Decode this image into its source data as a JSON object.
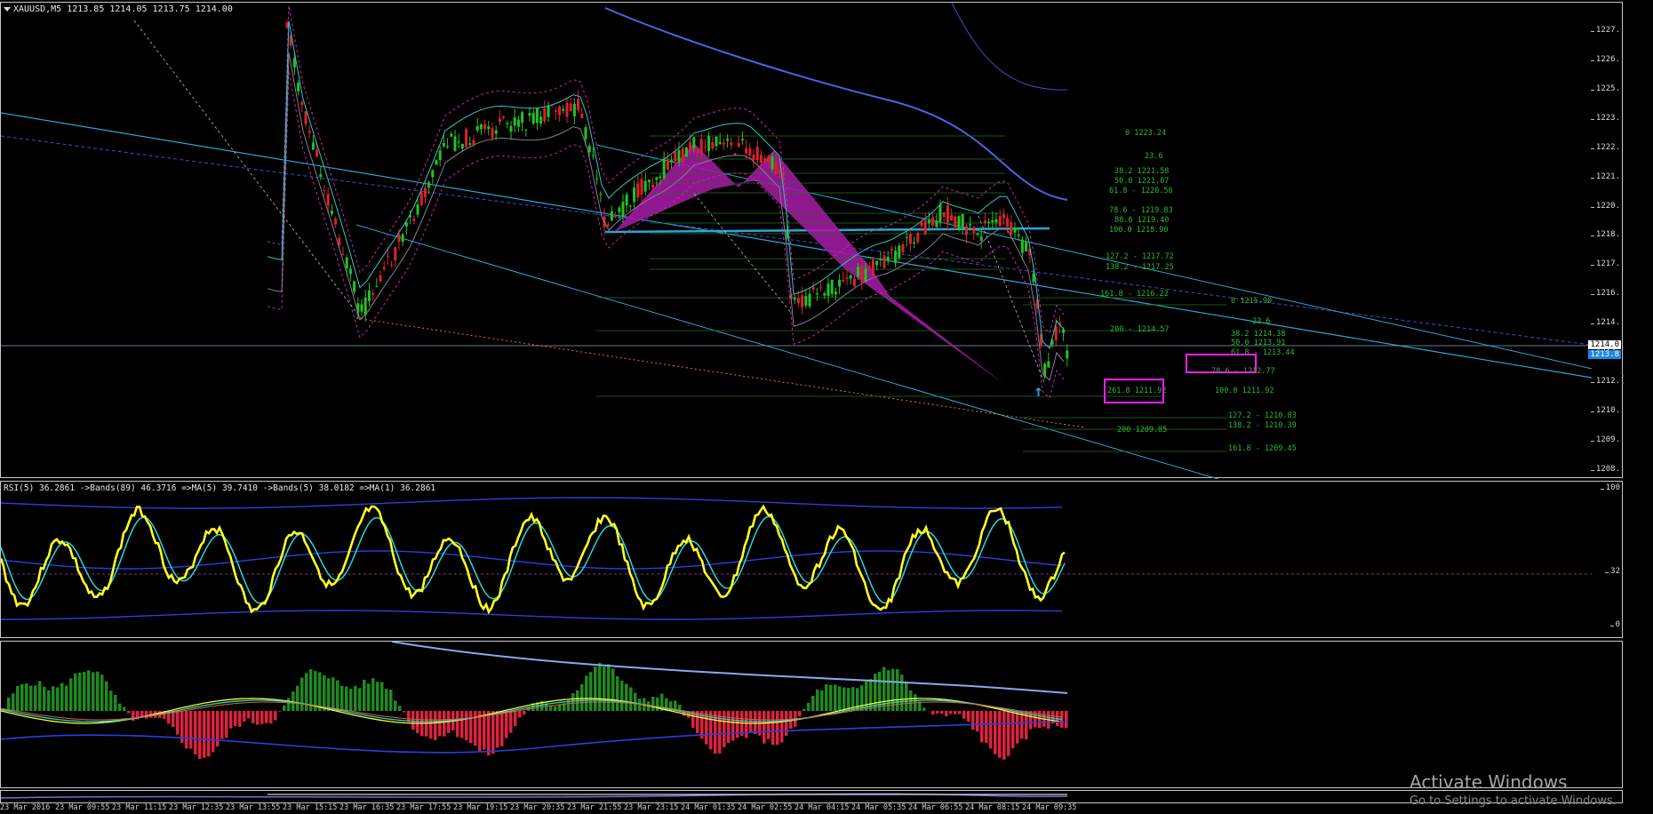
{
  "chart": {
    "symbol_header": "XAUUSD,M5  1213.85 1214.05 1213.75 1214.00",
    "current_price_tag": "1214.0",
    "current_price_tag_alt": "1213.8"
  },
  "price_axis": [
    "1227.",
    "1226.",
    "1225.",
    "1223.",
    "1222.",
    "1221.",
    "1220.",
    "1218.",
    "1217.",
    "1216.",
    "1214.",
    "1213.",
    "1212.",
    "1210.",
    "1209.",
    "1208."
  ],
  "fib_labels": {
    "f1": "0 1223.24",
    "f2": "23.6",
    "f3": "38.2 1221.58",
    "f4": "50.0 1221.07",
    "f5": "61.8 - 1220.56",
    "f6": "78.6 - 1219.83",
    "f7": "88.6 1219.40",
    "f8": "100.0 1218.90",
    "f9": "127.2 - 1217.72",
    "f10": "138.2 - 1217.25",
    "f11": "161.8 - 1216.22",
    "f12": "0 1215.90",
    "f13": "23.6",
    "f14": "200 - 1214.57",
    "f15": "38.2 1214.38",
    "f16": "50.0 1213.91",
    "f17": "61.8 - 1213.44",
    "f18": "78.6 - 1212.77",
    "f19": "261.8 1211.92",
    "f20": "100.0 1211.92",
    "f21": "127.2 - 1210.83",
    "f22": "138.2 - 1210.39",
    "f23": "200 1209.85",
    "f24": "161.8 - 1209.45"
  },
  "rsi": {
    "header": "RSI(5) 36.2861  ->Bands(89) 46.3716  =>MA(5) 39.7410  ->Bands(5) 38.0182  =>MA(1) 36.2861",
    "axis": [
      "100",
      "32",
      "0"
    ]
  },
  "time_axis": [
    "23 Mar 2016",
    "23 Mar 09:55",
    "23 Mar 11:15",
    "23 Mar 12:35",
    "23 Mar 13:55",
    "23 Mar 15:15",
    "23 Mar 16:35",
    "23 Mar 17:55",
    "23 Mar 19:15",
    "23 Mar 20:35",
    "23 Mar 21:55",
    "23 Mar 23:15",
    "24 Mar 01:35",
    "24 Mar 02:55",
    "24 Mar 04:15",
    "24 Mar 05:35",
    "24 Mar 06:55",
    "24 Mar 08:15",
    "24 Mar 09:35"
  ],
  "watermark": {
    "title": "Activate Windows",
    "subtitle": "Go to Settings to activate Windows."
  },
  "colors": {
    "background": "#000000",
    "candle_up": "#22c322",
    "candle_down": "#e0202c",
    "pattern": "#a01aa0",
    "highlight_box": "#ff1dff",
    "rsi_line": "#ffff20",
    "trend_line": "#2aa6d6"
  }
}
